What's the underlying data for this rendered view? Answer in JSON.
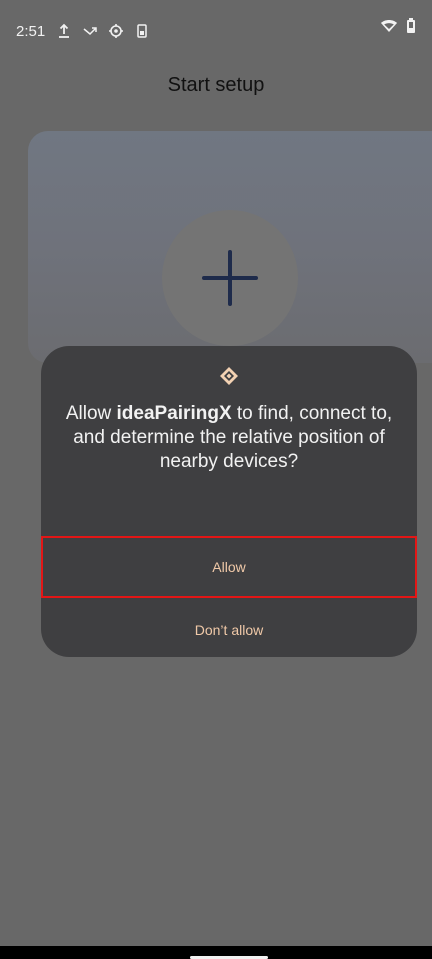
{
  "status_bar": {
    "time": "2:51",
    "icons_left": [
      "upload-icon",
      "missed-call-icon",
      "settings-icon",
      "battery-saver-icon"
    ],
    "icons_right": [
      "wifi-icon",
      "battery-icon"
    ]
  },
  "screen": {
    "title": "Start setup"
  },
  "hero": {
    "icon": "add-icon"
  },
  "dialog": {
    "icon": "nearby-devices-icon",
    "message_prefix": "Allow ",
    "app_name": "ideaPairingX",
    "message_suffix": " to find, connect to, and determine the relative position of nearby devices?",
    "allow_label": "Allow",
    "deny_label": "Don’t allow"
  },
  "colors": {
    "background": "#686868",
    "dialog_bg": "#3f3f41",
    "button_text": "#f0c9a8",
    "highlight": "#e31616"
  }
}
